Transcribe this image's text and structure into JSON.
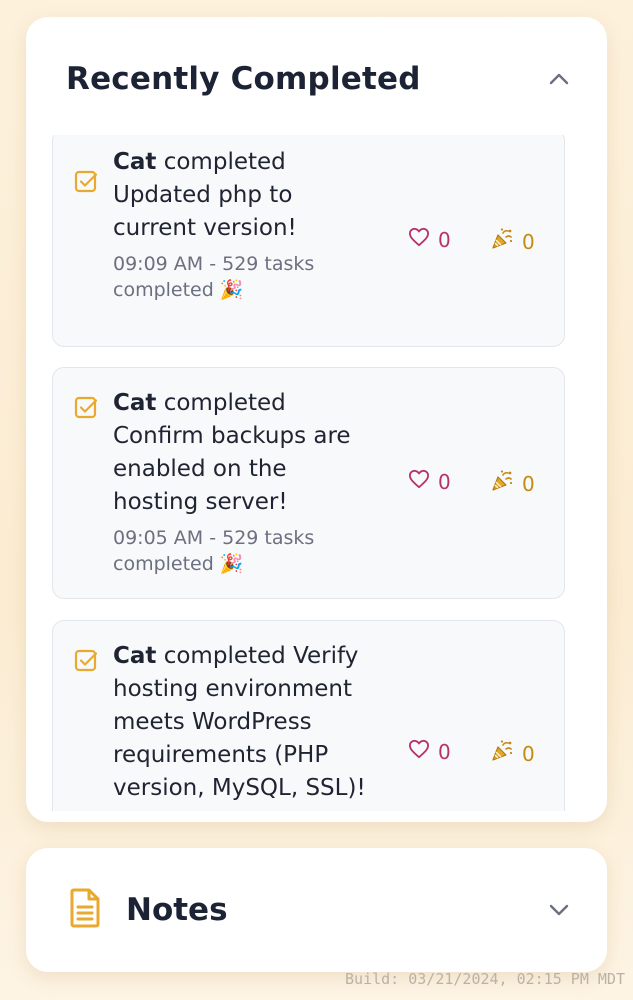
{
  "recent": {
    "title": "Recently Completed",
    "items": [
      {
        "user": "Cat",
        "verb": "completed",
        "task": "Updated php to current version!",
        "meta": "09:09 AM - 529 tasks completed 🎉",
        "hearts": "0",
        "celebrations": "0"
      },
      {
        "user": "Cat",
        "verb": "completed",
        "task": "Confirm backups are enabled on the hosting server!",
        "meta": "09:05 AM - 529 tasks completed 🎉",
        "hearts": "0",
        "celebrations": "0"
      },
      {
        "user": "Cat",
        "verb": "completed",
        "task": "Verify hosting environment meets WordPress requirements (PHP version, MySQL, SSL)!",
        "meta": "",
        "hearts": "0",
        "celebrations": "0"
      }
    ]
  },
  "notes": {
    "title": "Notes"
  },
  "footer": {
    "build": "Build: 03/21/2024, 02:15 PM MDT"
  },
  "colors": {
    "accent": "#e8a92e",
    "heart": "#b5336b",
    "party": "#c48a12"
  },
  "icons": {
    "collapse": "chevron-up-icon",
    "expand": "chevron-down-icon",
    "task": "checkbox-checked-icon",
    "heart": "heart-icon",
    "party": "party-popper-icon",
    "notes": "document-icon"
  }
}
